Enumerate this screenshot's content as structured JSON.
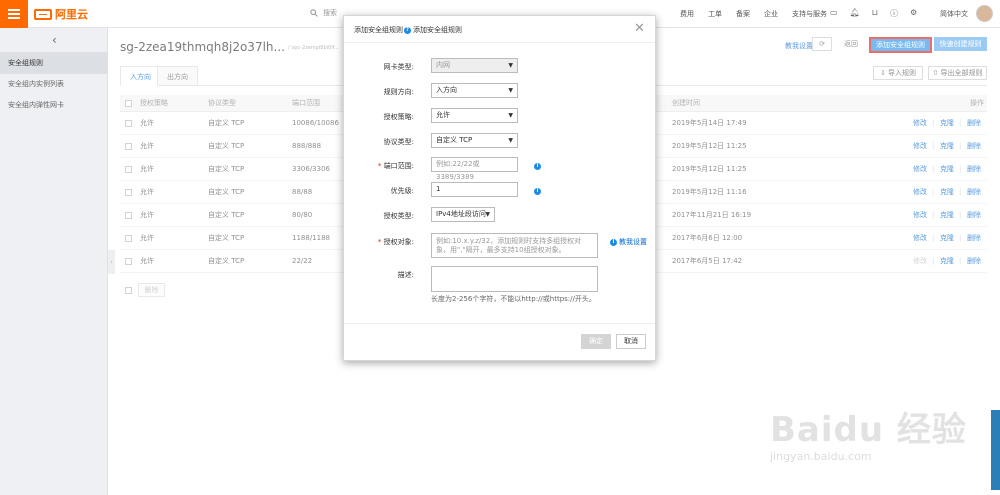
{
  "brand": {
    "name": "阿里云"
  },
  "search": {
    "placeholder": "搜索"
  },
  "nav": [
    "费用",
    "工单",
    "备案",
    "企业",
    "支持与服务"
  ],
  "header_icons": [
    "terminal-icon",
    "bell-icon",
    "cart-icon",
    "help-icon",
    "settings-icon"
  ],
  "language": "简体中文",
  "sidebar": {
    "items": [
      {
        "label": "安全组规则",
        "active": true
      },
      {
        "label": "安全组内实例列表",
        "active": false
      },
      {
        "label": "安全组内弹性网卡",
        "active": false
      }
    ]
  },
  "page": {
    "title": "sg-2zea19thmqh8j2o37lh...",
    "vpc": "/ vpc-2zempi8bi0lf...",
    "help_link": "教我设置",
    "back_label": "返回",
    "add_rule_label": "添加安全组规则",
    "quick_rule_label": "快速创建规则",
    "import_label": "导入规则",
    "export_label": "导出全部规则"
  },
  "tabs": [
    {
      "label": "入方向",
      "active": true
    },
    {
      "label": "出方向",
      "active": false
    }
  ],
  "table": {
    "columns": [
      "授权策略",
      "协议类型",
      "端口范围",
      "创建时间",
      "操作"
    ],
    "rows": [
      {
        "policy": "允许",
        "protocol": "自定义 TCP",
        "port": "10086/10086",
        "time": "2019年5月14日 17:49"
      },
      {
        "policy": "允许",
        "protocol": "自定义 TCP",
        "port": "888/888",
        "time": "2019年5月12日 11:25"
      },
      {
        "policy": "允许",
        "protocol": "自定义 TCP",
        "port": "3306/3306",
        "time": "2019年5月12日 11:25"
      },
      {
        "policy": "允许",
        "protocol": "自定义 TCP",
        "port": "88/88",
        "time": "2019年5月12日 11:16"
      },
      {
        "policy": "允许",
        "protocol": "自定义 TCP",
        "port": "80/80",
        "time": "2017年11月21日 16:19"
      },
      {
        "policy": "允许",
        "protocol": "自定义 TCP",
        "port": "1188/1188",
        "time": "2017年6月6日 12:00"
      },
      {
        "policy": "允许",
        "protocol": "自定义 TCP",
        "port": "22/22",
        "time": "2017年6月5日 17:42"
      }
    ],
    "actions": {
      "edit": "修改",
      "clone": "克隆",
      "delete": "删除"
    },
    "batch_delete": "删除"
  },
  "dialog": {
    "title": "添加安全组规则",
    "help": "添加安全组规则",
    "fields": {
      "nic_type": {
        "label": "网卡类型:",
        "value": "内网"
      },
      "direction": {
        "label": "规则方向:",
        "value": "入方向"
      },
      "policy": {
        "label": "授权策略:",
        "value": "允许"
      },
      "protocol": {
        "label": "协议类型:",
        "value": "自定义 TCP"
      },
      "port_range": {
        "label": "端口范围:",
        "placeholder": "例如:22/22或3389/3389"
      },
      "priority": {
        "label": "优先级:",
        "value": "1"
      },
      "auth_type": {
        "label": "授权类型:",
        "value": "IPv4地址段访问"
      },
      "auth_object": {
        "label": "授权对象:",
        "placeholder": "例如:10.x.y.z/32，添加规则时支持多组授权对象，用\",\"隔开，最多支持10组授权对象。",
        "help": "教我设置"
      },
      "description": {
        "label": "描述:",
        "hint": "长度为2-256个字符，不能以http://或https://开头。"
      }
    },
    "ok_label": "确定",
    "cancel_label": "取消"
  },
  "watermark": {
    "text": "Baidu 经验",
    "url": "jingyan.baidu.com"
  }
}
